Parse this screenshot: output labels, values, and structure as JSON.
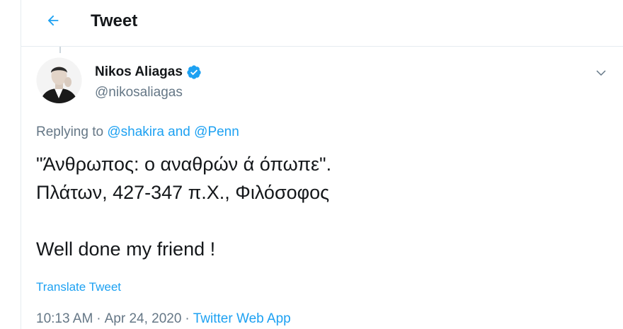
{
  "header": {
    "title": "Tweet",
    "back_icon": "arrow-left-icon"
  },
  "author": {
    "display_name": "Nikos Aliagas",
    "handle": "@nikosaliagas",
    "verified_icon": "verified-badge-icon",
    "menu_icon": "chevron-down-icon"
  },
  "replying": {
    "prefix": "Replying to",
    "user1": "@shakira",
    "conj": "and",
    "user2": "@Penn"
  },
  "tweet": {
    "lines": [
      "\"Άνθρωπος: ο αναθρών ά όπωπε\".",
      "Πλάτων, 427-347 π.Χ., Φιλόσοφος",
      "",
      "Well done my friend !"
    ]
  },
  "translate_label": "Translate Tweet",
  "meta": {
    "time": "10:13 AM",
    "date": "Apr 24, 2020",
    "source": "Twitter Web App",
    "separator": "·"
  },
  "colors": {
    "accent": "#1da1f2",
    "text": "#14171a",
    "secondary": "#657786",
    "border": "#e6ecf0"
  }
}
